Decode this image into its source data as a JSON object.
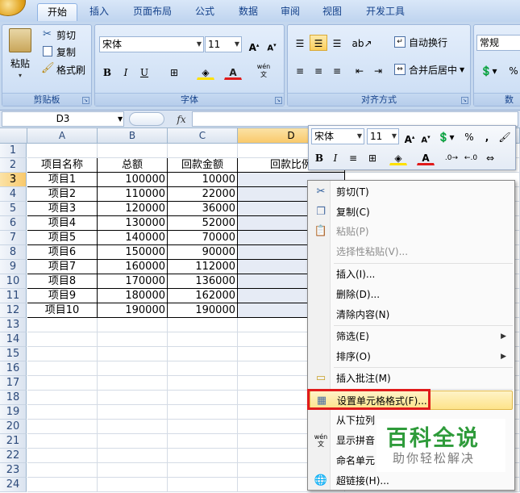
{
  "ribbon": {
    "tabs": [
      "开始",
      "插入",
      "页面布局",
      "公式",
      "数据",
      "审阅",
      "视图",
      "开发工具"
    ],
    "clipboard": {
      "paste": "粘贴",
      "cut": "剪切",
      "copy": "复制",
      "format_painter": "格式刷",
      "label": "剪贴板"
    },
    "font": {
      "name": "宋体",
      "size": "11",
      "label": "字体",
      "phonetic": "wén\n文"
    },
    "alignment": {
      "wrap": "自动换行",
      "merge": "合并后居中",
      "label": "对齐方式"
    },
    "number": {
      "format": "常规",
      "label": "数",
      "percent": "%"
    }
  },
  "formula_bar": {
    "name_box": "D3",
    "fx": "fx",
    "value": ""
  },
  "sheet": {
    "columns": [
      "A",
      "B",
      "C",
      "D"
    ],
    "rows": [
      "1",
      "2",
      "3",
      "4",
      "5",
      "6",
      "7",
      "8",
      "9",
      "10",
      "11",
      "12",
      "13",
      "14",
      "15",
      "16",
      "17",
      "18",
      "19",
      "20",
      "21",
      "22",
      "23",
      "24"
    ],
    "headers": [
      "项目名称",
      "总额",
      "回款金额",
      "回款比例"
    ],
    "data": [
      [
        "项目1",
        "100000",
        "10000"
      ],
      [
        "项目2",
        "110000",
        "22000"
      ],
      [
        "项目3",
        "120000",
        "36000"
      ],
      [
        "项目4",
        "130000",
        "52000"
      ],
      [
        "项目5",
        "140000",
        "70000"
      ],
      [
        "项目6",
        "150000",
        "90000"
      ],
      [
        "项目7",
        "160000",
        "112000"
      ],
      [
        "项目8",
        "170000",
        "136000"
      ],
      [
        "项目9",
        "180000",
        "162000"
      ],
      [
        "项目10",
        "190000",
        "190000"
      ]
    ]
  },
  "mini_toolbar": {
    "font": "宋体",
    "size": "11",
    "percent": "%",
    "comma": ","
  },
  "context_menu": {
    "cut": "剪切(T)",
    "copy": "复制(C)",
    "paste": "粘贴(P)",
    "paste_special": "选择性粘贴(V)...",
    "insert": "插入(I)...",
    "delete": "删除(D)...",
    "clear": "清除内容(N)",
    "filter": "筛选(E)",
    "sort": "排序(O)",
    "insert_comment": "插入批注(M)",
    "format_cells": "设置单元格格式(F)...",
    "pick_list": "从下拉列",
    "show_phonetic": "显示拼音",
    "name_range": "命名单元",
    "hyperlink": "超链接(H)..."
  },
  "watermark": {
    "title": "百科全说",
    "subtitle": "助你轻松解决"
  },
  "colors": {
    "ribbon_bg": "#c4d7ee",
    "selected_header": "#f9c96b",
    "highlight": "#fde38a",
    "red_box": "#e01b1b",
    "watermark_green": "#2e9b3a"
  }
}
